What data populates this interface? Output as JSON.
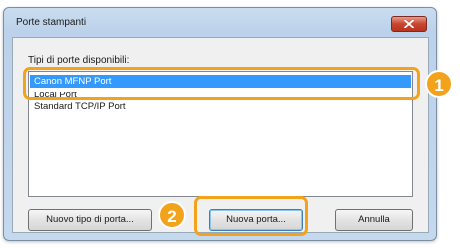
{
  "window": {
    "title": "Porte stampanti"
  },
  "dialog": {
    "available_label": "Tipi di porte disponibili:",
    "port_types": [
      "Canon MFNP Port",
      "Local Port",
      "Standard TCP/IP Port"
    ],
    "selected_index": 0
  },
  "buttons": {
    "new_port_type": "Nuovo tipo di porta...",
    "new_port": "Nuova porta...",
    "cancel": "Annulla"
  },
  "callouts": {
    "first": "1",
    "second": "2"
  },
  "colors": {
    "callout": "#f2a31b",
    "selection": "#3399ff",
    "close_button": "#c8452e"
  },
  "icons": {
    "close": "close-icon"
  }
}
